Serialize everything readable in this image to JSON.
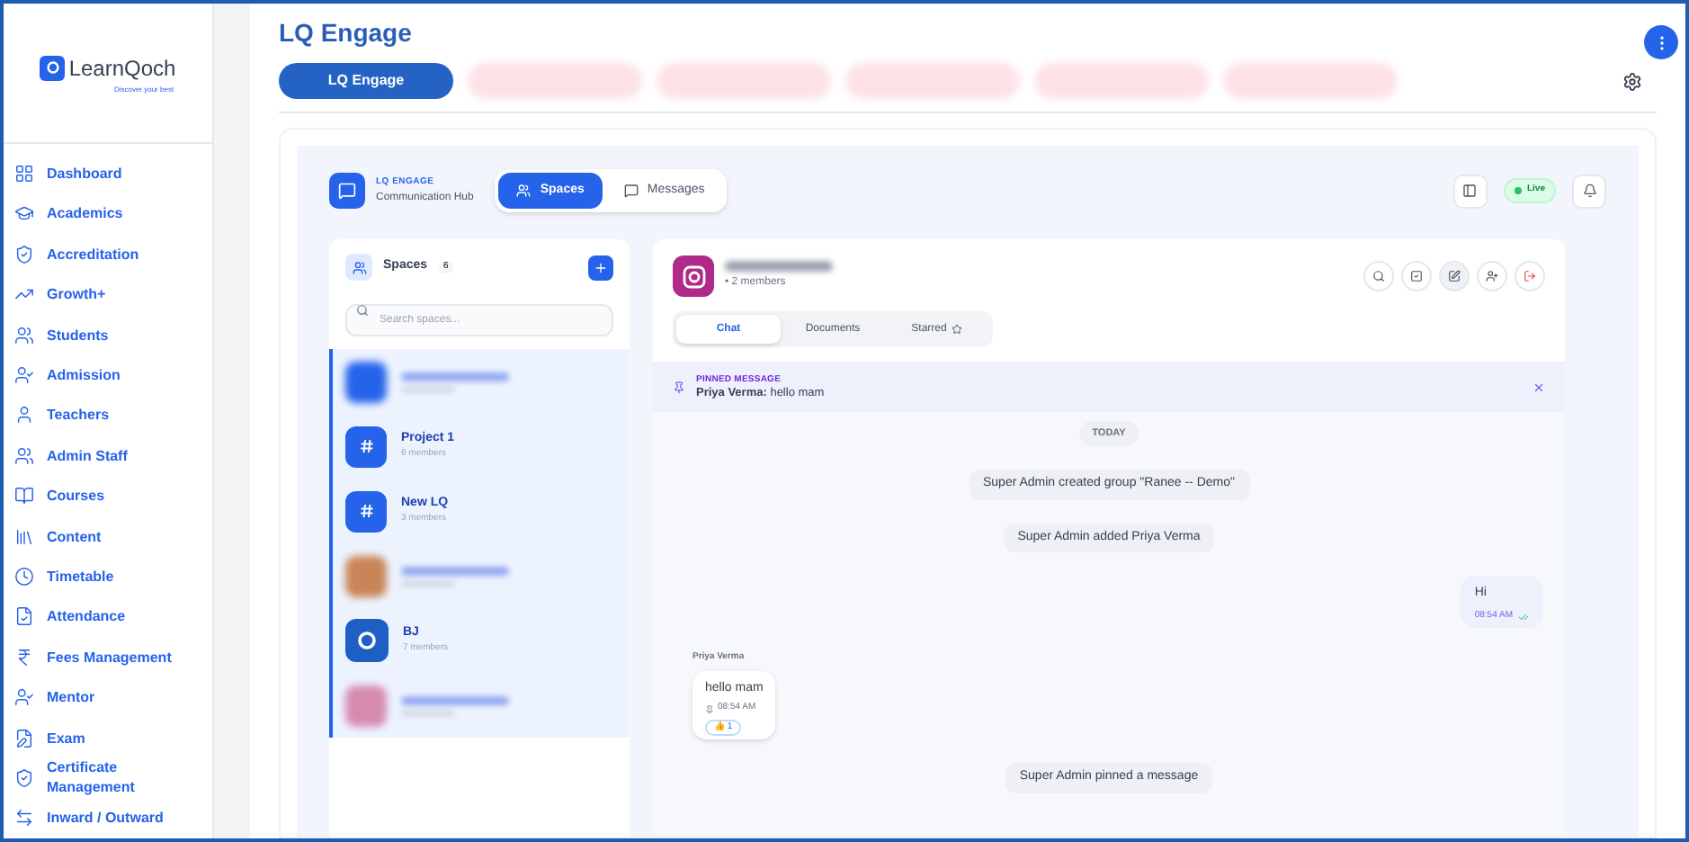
{
  "brand": {
    "name": "LearnQoch",
    "tagline": "Discover your best"
  },
  "sidebar": {
    "items": [
      {
        "label": "Dashboard"
      },
      {
        "label": "Academics"
      },
      {
        "label": "Accreditation"
      },
      {
        "label": "Growth+"
      },
      {
        "label": "Students"
      },
      {
        "label": "Admission"
      },
      {
        "label": "Teachers"
      },
      {
        "label": "Admin Staff"
      },
      {
        "label": "Courses"
      },
      {
        "label": "Content"
      },
      {
        "label": "Timetable"
      },
      {
        "label": "Attendance"
      },
      {
        "label": "Fees Management"
      },
      {
        "label": "Mentor"
      },
      {
        "label": "Exam"
      },
      {
        "label": "Certificate Management"
      },
      {
        "label": "Inward / Outward"
      }
    ]
  },
  "page": {
    "title": "LQ Engage"
  },
  "tabs": [
    {
      "kind": "text",
      "label": "LQ Engage",
      "selected": true
    },
    {
      "kind": "redacted",
      "selected": false
    },
    {
      "kind": "redacted",
      "selected": false
    },
    {
      "kind": "redacted",
      "selected": false
    },
    {
      "kind": "redacted",
      "selected": false
    },
    {
      "kind": "redacted",
      "selected": false
    }
  ],
  "hub": {
    "eyebrow": "LQ ENGAGE",
    "subtitle": "Communication Hub",
    "views": [
      {
        "label": "Spaces",
        "selected": true
      },
      {
        "label": "Messages",
        "selected": false
      }
    ],
    "status": "Live"
  },
  "spaces": {
    "title": "Spaces",
    "count": "6",
    "search_placeholder": "Search spaces...",
    "items": [
      {
        "kind": "redacted-tile"
      },
      {
        "kind": "hash",
        "name": "Project 1",
        "members": "6 members"
      },
      {
        "kind": "hash",
        "name": "New LQ",
        "members": "3 members"
      },
      {
        "kind": "redacted-photo"
      },
      {
        "kind": "logo",
        "name": "BJ",
        "members": "7 members"
      },
      {
        "kind": "redacted-gradient"
      }
    ]
  },
  "chat": {
    "members": "• 2 members",
    "tabs": [
      {
        "label": "Chat",
        "selected": true
      },
      {
        "label": "Documents",
        "selected": false
      },
      {
        "label": "Starred",
        "selected": false
      }
    ],
    "pinned": {
      "label": "PINNED MESSAGE",
      "sender": "Priya Verma:",
      "text": "hello mam"
    },
    "day": "TODAY",
    "messages": [
      {
        "kind": "system",
        "text": "Super Admin created group \"Ranee -- Demo\""
      },
      {
        "kind": "system",
        "text": "Super Admin added Priya Verma"
      },
      {
        "kind": "outgoing",
        "text": "Hi",
        "time": "08:54 AM"
      },
      {
        "kind": "incoming",
        "sender": "Priya Verma",
        "text": "hello mam",
        "time": "08:54 AM",
        "reaction_emoji": "👍",
        "reaction": "1"
      },
      {
        "kind": "system",
        "text": "Super Admin pinned a message"
      }
    ]
  }
}
